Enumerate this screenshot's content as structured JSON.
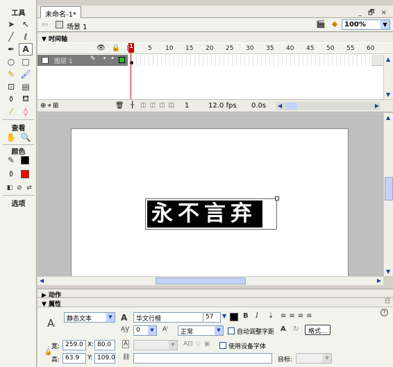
{
  "tools_panel": {
    "heading_tools": "工具",
    "heading_view": "查看",
    "heading_colors": "颜色",
    "heading_options": "选项",
    "stroke_color": "#000000",
    "fill_color": "#ff0000"
  },
  "document": {
    "tab_title": "未命名-1*",
    "window_controls": "_ 🗗 ×",
    "scene_label": "场景 1",
    "zoom": "100%"
  },
  "timeline": {
    "panel_title": "▼ 时间轴",
    "layer_columns": "👁 🔒 □",
    "ticks": [
      "1",
      "5",
      "10",
      "15",
      "20",
      "25",
      "30",
      "35",
      "40",
      "45",
      "50",
      "55",
      "60"
    ],
    "layer_name": "图层 1",
    "current_frame": "1",
    "fps": "12.0 fps",
    "elapsed": "0.0s"
  },
  "stage": {
    "text": "永不言弃"
  },
  "panels": {
    "actions_title": "▶ 动作",
    "properties_title": "▼ 属性",
    "menu_icon": "☷"
  },
  "properties": {
    "text_type": "静态文本",
    "font": "华文行楷",
    "font_size": "57",
    "bold": "B",
    "italic": "I",
    "letter_spacing": "0",
    "char_position": "正常",
    "auto_kern_label": "自动调整字距",
    "format_button": "格式...",
    "width_label": "宽:",
    "width_value": "259.0",
    "height_label": "高:",
    "height_value": "63.9",
    "x_label": "X:",
    "x_value": "80.0",
    "y_label": "Y:",
    "y_value": "109.0",
    "device_fonts_label": "使用设备字体",
    "target_label": "目标:",
    "help": "?"
  }
}
